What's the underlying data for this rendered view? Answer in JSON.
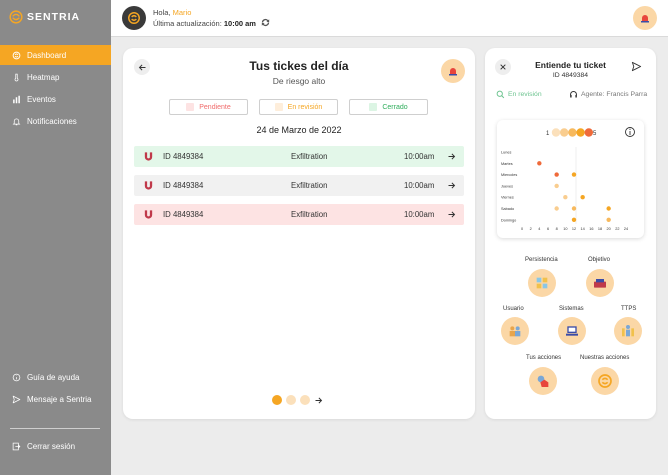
{
  "brand": {
    "name": "SENTRIA",
    "accent": "#f5a623"
  },
  "sidebar": {
    "items": [
      {
        "label": "Dashboard",
        "icon": "dashboard-icon",
        "active": true
      },
      {
        "label": "Heatmap",
        "icon": "thermometer-icon"
      },
      {
        "label": "Eventos",
        "icon": "bar-chart-icon"
      },
      {
        "label": "Notificaciones",
        "icon": "bell-icon"
      }
    ],
    "footer": [
      {
        "label": "Guía de ayuda",
        "icon": "info-icon"
      },
      {
        "label": "Mensaje a Sentria",
        "icon": "send-icon"
      }
    ],
    "logout": "Cerrar sesión"
  },
  "header": {
    "greeting_prefix": "Hola,",
    "user": "Mario",
    "update_label": "Última actualización:",
    "update_time": "10:00 am"
  },
  "tickets": {
    "title": "Tus tickes del día",
    "subtitle": "De riesgo alto",
    "filters": [
      {
        "label": "Pendiente",
        "color": "#f06b6b",
        "swatch": "#fde3e3"
      },
      {
        "label": "En revisión",
        "color": "#f5a623",
        "swatch": "#feeedb"
      },
      {
        "label": "Cerrado",
        "color": "#2fae5c",
        "swatch": "#dcf5e4"
      }
    ],
    "date": "24 de Marzo de 2022",
    "rows": [
      {
        "id": "ID 4849384",
        "type": "Exfiltration",
        "time": "10:00am",
        "bg": "#e3f7e9"
      },
      {
        "id": "ID 4849384",
        "type": "Exfiltration",
        "time": "10:00am",
        "bg": "#f1f1f1"
      },
      {
        "id": "ID 4849384",
        "type": "Exfiltration",
        "time": "10:00am",
        "bg": "#fde3e3"
      }
    ]
  },
  "detail": {
    "title": "Entiende tu ticket",
    "id": "ID 4849384",
    "status": "En revisión",
    "agent": "Agente: Francis Parra",
    "scale_min": "1",
    "scale_max": "5",
    "categories": [
      {
        "label": "Persistencia",
        "icon": "puzzle-icon"
      },
      {
        "label": "Objetivo",
        "icon": "target-icon"
      },
      {
        "label": "Usuario",
        "icon": "user-group-icon"
      },
      {
        "label": "Sistemas",
        "icon": "server-icon"
      },
      {
        "label": "TTPS",
        "icon": "people-icon"
      },
      {
        "label": "Tus acciones",
        "icon": "hand-icon"
      },
      {
        "label": "Nuestras acciones",
        "icon": "sentria-icon"
      }
    ]
  },
  "chart_data": {
    "type": "scatter",
    "categories": [
      "Lunes",
      "Martes",
      "Miercoles",
      "Jueves",
      "Viernes",
      "Sabado",
      "Domingo"
    ],
    "x_ticks": [
      0,
      2,
      4,
      6,
      8,
      10,
      12,
      14,
      16,
      18,
      20,
      22,
      24
    ],
    "xlim": [
      0,
      24
    ],
    "legend_scale": [
      1,
      2,
      3,
      4,
      5
    ],
    "points": [
      {
        "day": "Martes",
        "hour": 4,
        "level": 5
      },
      {
        "day": "Miercoles",
        "hour": 8,
        "level": 5
      },
      {
        "day": "Miercoles",
        "hour": 12,
        "level": 4
      },
      {
        "day": "Jueves",
        "hour": 8,
        "level": 2
      },
      {
        "day": "Viernes",
        "hour": 10,
        "level": 2
      },
      {
        "day": "Viernes",
        "hour": 14,
        "level": 4
      },
      {
        "day": "Sabado",
        "hour": 8,
        "level": 2
      },
      {
        "day": "Sabado",
        "hour": 12,
        "level": 3
      },
      {
        "day": "Sabado",
        "hour": 20,
        "level": 4
      },
      {
        "day": "Domingo",
        "hour": 12,
        "level": 4
      },
      {
        "day": "Domingo",
        "hour": 20,
        "level": 3
      }
    ],
    "colors": [
      "#fbe0bb",
      "#f9cd8f",
      "#f7b95d",
      "#f5a623",
      "#ef6a3a"
    ],
    "grid": false
  }
}
